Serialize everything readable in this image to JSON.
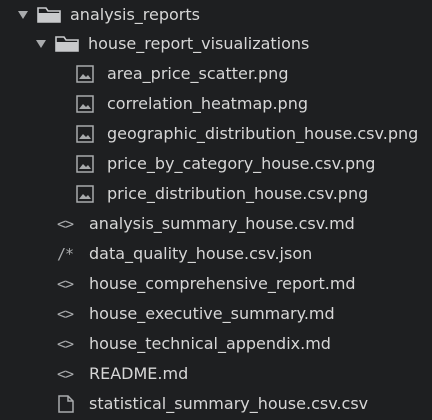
{
  "tree": {
    "root": {
      "label": "analysis_reports",
      "icon": "folder-icon",
      "expanded": true
    },
    "subfolder": {
      "label": "house_report_visualizations",
      "icon": "folder-icon",
      "expanded": true
    },
    "images": [
      {
        "label": "area_price_scatter.png",
        "icon": "image-icon"
      },
      {
        "label": "correlation_heatmap.png",
        "icon": "image-icon"
      },
      {
        "label": "geographic_distribution_house.csv.png",
        "icon": "image-icon"
      },
      {
        "label": "price_by_category_house.csv.png",
        "icon": "image-icon"
      },
      {
        "label": "price_distribution_house.csv.png",
        "icon": "image-icon"
      }
    ],
    "files": [
      {
        "label": "analysis_summary_house.csv.md",
        "icon": "code-icon",
        "glyph": "<>"
      },
      {
        "label": "data_quality_house.csv.json",
        "icon": "json-icon",
        "glyph": "/*"
      },
      {
        "label": "house_comprehensive_report.md",
        "icon": "code-icon",
        "glyph": "<>"
      },
      {
        "label": "house_executive_summary.md",
        "icon": "code-icon",
        "glyph": "<>"
      },
      {
        "label": "house_technical_appendix.md",
        "icon": "code-icon",
        "glyph": "<>"
      },
      {
        "label": "README.md",
        "icon": "code-icon",
        "glyph": "<>"
      },
      {
        "label": "statistical_summary_house.csv.csv",
        "icon": "file-icon",
        "glyph": ""
      }
    ]
  }
}
